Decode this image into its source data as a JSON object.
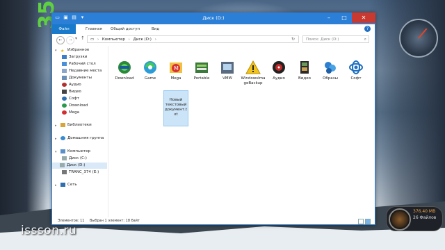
{
  "desktop": {
    "watermark": "issson.ru",
    "gadget_drive_size": "376.40 MB",
    "gadget_drive_files": "26 Файлов"
  },
  "window": {
    "title": "Диск (D:)",
    "ribbon_tabs": [
      "Файл",
      "Главная",
      "Общий доступ",
      "Вид"
    ],
    "address": {
      "crumbs": [
        "Компьютер",
        "Диск (D:)"
      ]
    },
    "search_placeholder": "Поиск: Диск (D:)",
    "accent": "#2c7fd6"
  },
  "nav_pane": {
    "favorites_label": "Избранное",
    "favorites": [
      "Загрузки",
      "Рабочий стол",
      "Недавние места",
      "Документы",
      "Аудио",
      "Видео",
      "Софт",
      "Download",
      "Mega"
    ],
    "libraries_label": "Библиотеки",
    "homegroup_label": "Домашняя группа",
    "computer_label": "Компьютер",
    "computer_items": [
      "Диск (C:)",
      "Диск (D:)",
      "TRANC_374 (E:)"
    ],
    "network_label": "Сеть"
  },
  "files": [
    {
      "name": "Download",
      "icon": "download-folder-icon"
    },
    {
      "name": "Game",
      "icon": "game-folder-icon"
    },
    {
      "name": "Mega",
      "icon": "mega-folder-icon"
    },
    {
      "name": "Portable",
      "icon": "portable-folder-icon"
    },
    {
      "name": "VMW",
      "icon": "vmw-folder-icon"
    },
    {
      "name": "WindowsImageBackup",
      "icon": "warning-folder-icon"
    },
    {
      "name": "Аудио",
      "icon": "audio-folder-icon"
    },
    {
      "name": "Видео",
      "icon": "video-folder-icon"
    },
    {
      "name": "Образы",
      "icon": "images-folder-icon"
    },
    {
      "name": "Софт",
      "icon": "soft-folder-icon"
    },
    {
      "name": "Новый текстовый документ.txt",
      "icon": "text-file-icon"
    }
  ],
  "status": {
    "count": "Элементов: 11",
    "selection": "Выбран 1 элемент: 18 байт"
  }
}
